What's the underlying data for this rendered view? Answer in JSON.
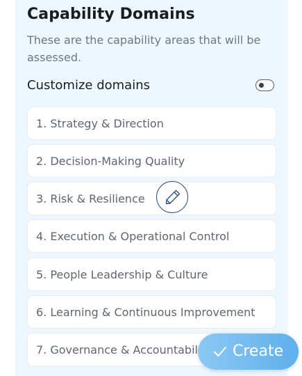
{
  "header": {
    "title": "Capability Domains",
    "subtitle": "These are the capability areas that will be assessed."
  },
  "customize": {
    "label": "Customize domains",
    "enabled": false
  },
  "domains": [
    {
      "label": "1. Strategy & Direction"
    },
    {
      "label": "2. Decision-Making Quality"
    },
    {
      "label": "3. Risk & Resilience"
    },
    {
      "label": "4. Execution & Operational Control"
    },
    {
      "label": "5. People Leadership & Culture"
    },
    {
      "label": "6. Learning & Continuous Improvement"
    },
    {
      "label": "7. Governance & Accountability"
    }
  ],
  "actions": {
    "create_label": "Create",
    "edit_icon": "pencil-icon",
    "create_icon": "check-icon"
  },
  "colors": {
    "panel_bg": "#eef7fd",
    "accent": "#5fb0ec",
    "edit_outline": "#2d4e86"
  }
}
